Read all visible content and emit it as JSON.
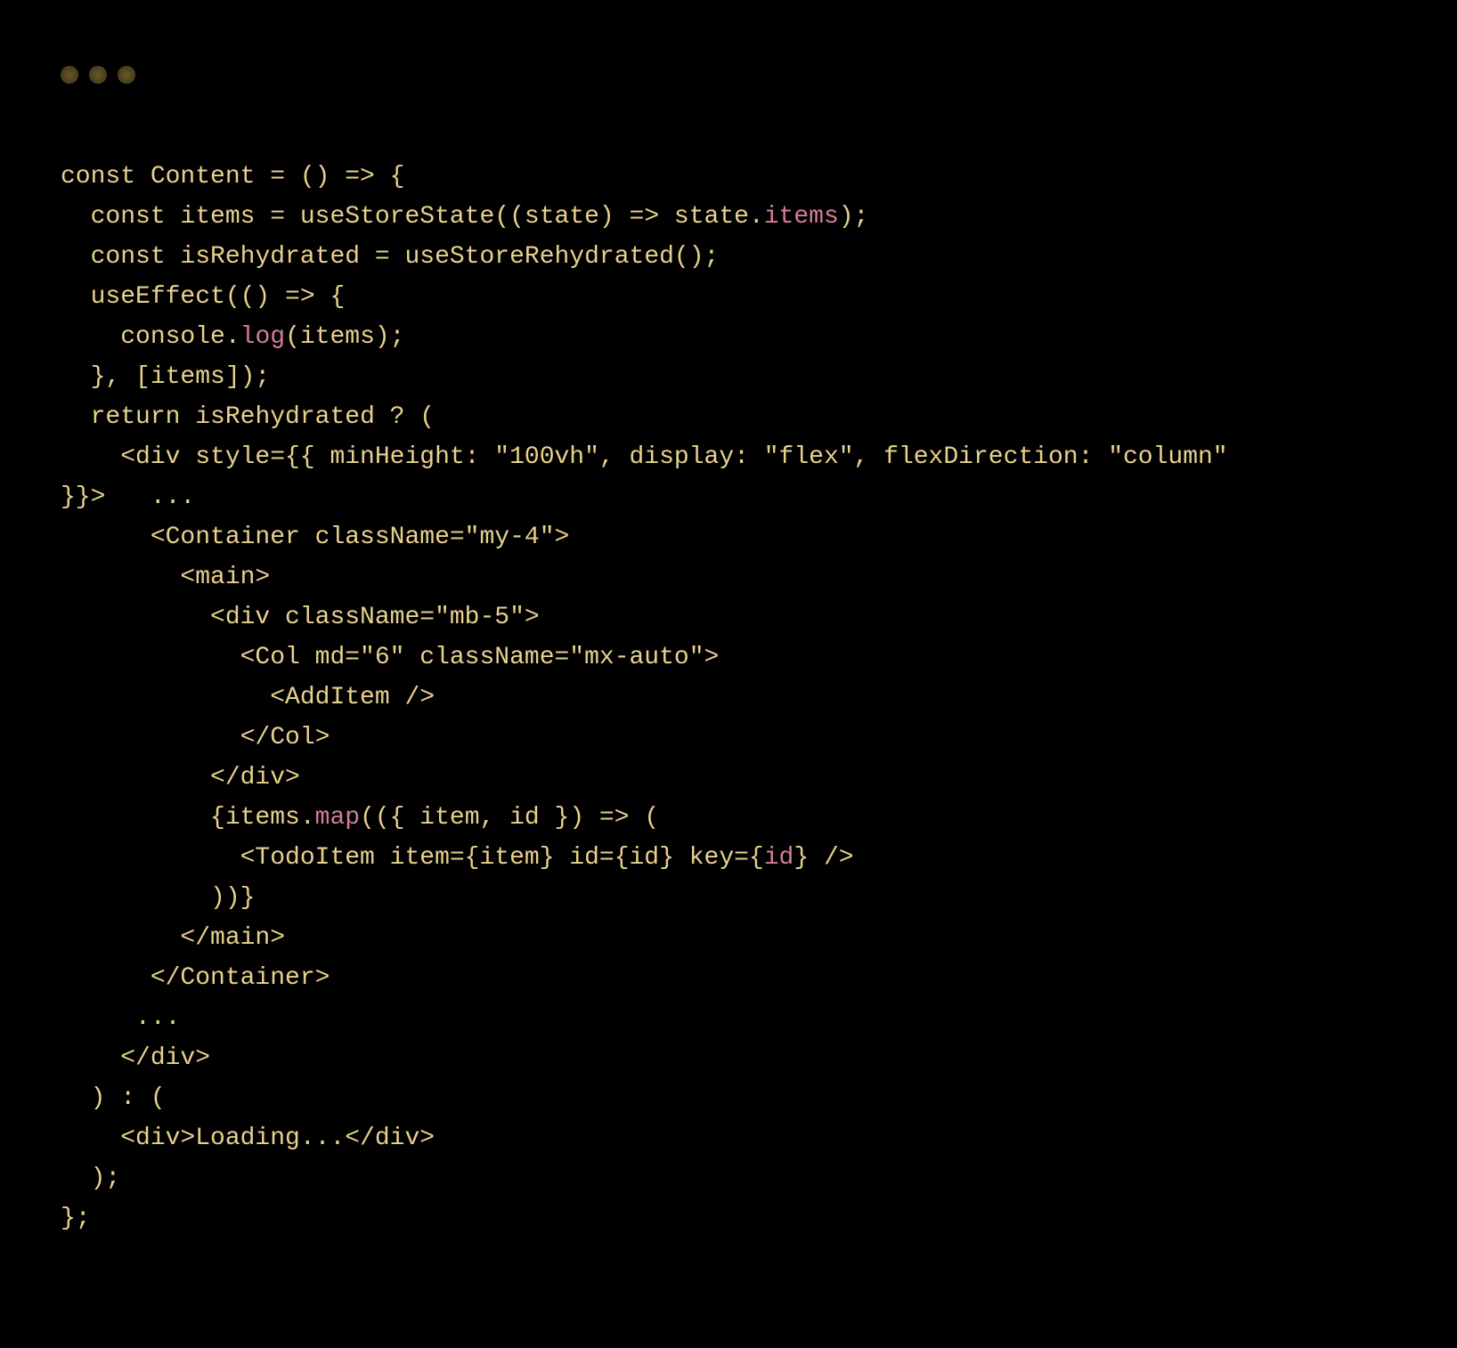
{
  "window": {
    "traffic_lights": [
      "close",
      "minimize",
      "zoom"
    ]
  },
  "code": {
    "lines": [
      [
        {
          "t": "const",
          "c": "kw"
        },
        {
          "t": " Content = () => {",
          "c": "punct"
        }
      ],
      [
        {
          "t": "  ",
          "c": "punct"
        },
        {
          "t": "const",
          "c": "kw"
        },
        {
          "t": " items = useStoreState((state) => state.",
          "c": "punct"
        },
        {
          "t": "items",
          "c": "pink"
        },
        {
          "t": ");",
          "c": "punct"
        }
      ],
      [
        {
          "t": "  ",
          "c": "punct"
        },
        {
          "t": "const",
          "c": "kw"
        },
        {
          "t": " isRehydrated = useStoreRehydrated();",
          "c": "punct"
        }
      ],
      [
        {
          "t": "  useEffect(() => {",
          "c": "punct"
        }
      ],
      [
        {
          "t": "    console.",
          "c": "punct"
        },
        {
          "t": "log",
          "c": "pink"
        },
        {
          "t": "(items);",
          "c": "punct"
        }
      ],
      [
        {
          "t": "  }, [items]);",
          "c": "punct"
        }
      ],
      [
        {
          "t": "  ",
          "c": "punct"
        },
        {
          "t": "return",
          "c": "retkw"
        },
        {
          "t": " isRehydrated ? (",
          "c": "punct"
        }
      ],
      [
        {
          "t": "    <div style={{ minHeight: \"100vh\", display: \"flex\", flexDirection: \"column\"",
          "c": "punct"
        }
      ],
      [
        {
          "t": "}}>   ...",
          "c": "punct",
          "outdent": true
        }
      ],
      [
        {
          "t": "      <Container className=\"my-4\">",
          "c": "punct"
        }
      ],
      [
        {
          "t": "        <main>",
          "c": "punct"
        }
      ],
      [
        {
          "t": "          <div className=\"mb-5\">",
          "c": "punct"
        }
      ],
      [
        {
          "t": "            <Col md=\"6\" className=\"mx-auto\">",
          "c": "punct"
        }
      ],
      [
        {
          "t": "              <AddItem />",
          "c": "punct"
        }
      ],
      [
        {
          "t": "            </Col>",
          "c": "punct"
        }
      ],
      [
        {
          "t": "          </div>",
          "c": "punct"
        }
      ],
      [
        {
          "t": "          {items.",
          "c": "punct"
        },
        {
          "t": "map",
          "c": "pink"
        },
        {
          "t": "(({ item, id }) => (",
          "c": "punct"
        }
      ],
      [
        {
          "t": "            <TodoItem item={item} id={id} key={",
          "c": "punct"
        },
        {
          "t": "id",
          "c": "pink"
        },
        {
          "t": "} />",
          "c": "punct"
        }
      ],
      [
        {
          "t": "          ))}",
          "c": "punct"
        }
      ],
      [
        {
          "t": "        </main>",
          "c": "punct"
        }
      ],
      [
        {
          "t": "      </Container>",
          "c": "punct"
        }
      ],
      [
        {
          "t": "     ...",
          "c": "punct"
        }
      ],
      [
        {
          "t": "    </div>",
          "c": "punct"
        }
      ],
      [
        {
          "t": "  ) : (",
          "c": "punct"
        }
      ],
      [
        {
          "t": "    <div>Loading...</div>",
          "c": "punct"
        }
      ],
      [
        {
          "t": "  );",
          "c": "punct"
        }
      ],
      [
        {
          "t": "};",
          "c": "punct"
        }
      ]
    ]
  }
}
